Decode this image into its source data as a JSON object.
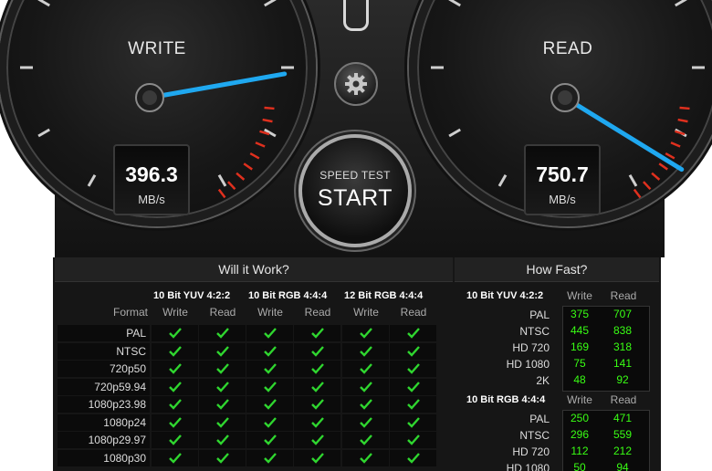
{
  "write_gauge": {
    "title": "WRITE",
    "value": "396.3",
    "unit": "MB/s",
    "level": 0.66
  },
  "read_gauge": {
    "title": "READ",
    "value": "750.7",
    "unit": "MB/s",
    "level": 0.82
  },
  "start_button": {
    "caption": "SPEED TEST",
    "label": "START"
  },
  "will_it_work": {
    "title": "Will it Work?",
    "format_label": "Format",
    "groups": [
      {
        "name": "10 Bit YUV 4:2:2",
        "write": "Write",
        "read": "Read"
      },
      {
        "name": "10 Bit RGB 4:4:4",
        "write": "Write",
        "read": "Read"
      },
      {
        "name": "12 Bit RGB 4:4:4",
        "write": "Write",
        "read": "Read"
      }
    ],
    "rows": [
      "PAL",
      "NTSC",
      "720p50",
      "720p59.94",
      "1080p23.98",
      "1080p24",
      "1080p29.97",
      "1080p30"
    ],
    "check": "✔"
  },
  "how_fast": {
    "title": "How Fast?",
    "groups": [
      {
        "name": "10 Bit YUV 4:2:2",
        "write": "Write",
        "read": "Read",
        "rows": [
          {
            "label": "PAL",
            "write": "375",
            "read": "707"
          },
          {
            "label": "NTSC",
            "write": "445",
            "read": "838"
          },
          {
            "label": "HD 720",
            "write": "169",
            "read": "318"
          },
          {
            "label": "HD 1080",
            "write": "75",
            "read": "141"
          },
          {
            "label": "2K",
            "write": "48",
            "read": "92"
          }
        ]
      },
      {
        "name": "10 Bit RGB 4:4:4",
        "write": "Write",
        "read": "Read",
        "rows": [
          {
            "label": "PAL",
            "write": "250",
            "read": "471"
          },
          {
            "label": "NTSC",
            "write": "296",
            "read": "559"
          },
          {
            "label": "HD 720",
            "write": "112",
            "read": "212"
          },
          {
            "label": "HD 1080",
            "write": "50",
            "read": "94"
          }
        ]
      }
    ]
  },
  "colors": {
    "needle": "#1fa8f0",
    "redline": "#e0301e",
    "value_green": "#39ff14",
    "check_green": "#2fd62f"
  },
  "icons": {
    "settings": "gear-icon",
    "check": "check-icon"
  }
}
